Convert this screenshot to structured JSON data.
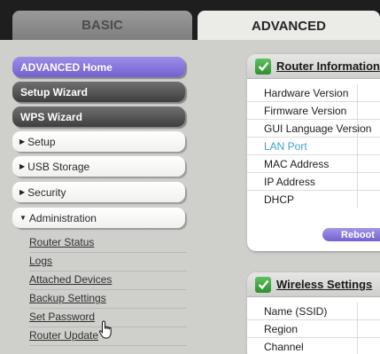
{
  "tabs": {
    "basic": "BASIC",
    "advanced": "ADVANCED"
  },
  "nav": {
    "home": "ADVANCED Home",
    "setup_wizard": "Setup Wizard",
    "wps_wizard": "WPS Wizard",
    "setup": "Setup",
    "usb_storage": "USB Storage",
    "security": "Security",
    "administration": "Administration",
    "admin_items": [
      "Router Status",
      "Logs",
      "Attached Devices",
      "Backup Settings",
      "Set Password",
      "Router Update"
    ]
  },
  "router_panel": {
    "title": "Router Information",
    "rows": [
      "Hardware Version",
      "Firmware Version",
      "GUI Language Version",
      "LAN Port",
      "MAC Address",
      "IP Address",
      "DHCP"
    ],
    "button": "Reboot"
  },
  "wireless_panel": {
    "title": "Wireless Settings",
    "rows": [
      "Name (SSID)",
      "Region",
      "Channel"
    ]
  },
  "colors": {
    "accent_purple": "#7261cf",
    "link_blue": "#3da3c8",
    "check_green": "#2e8f2e"
  },
  "icons": {
    "panel_check": "checkmark-icon",
    "expand_arrow": "triangle-right-icon",
    "collapse_arrow": "triangle-down-icon",
    "cursor": "hand-pointer-icon"
  }
}
